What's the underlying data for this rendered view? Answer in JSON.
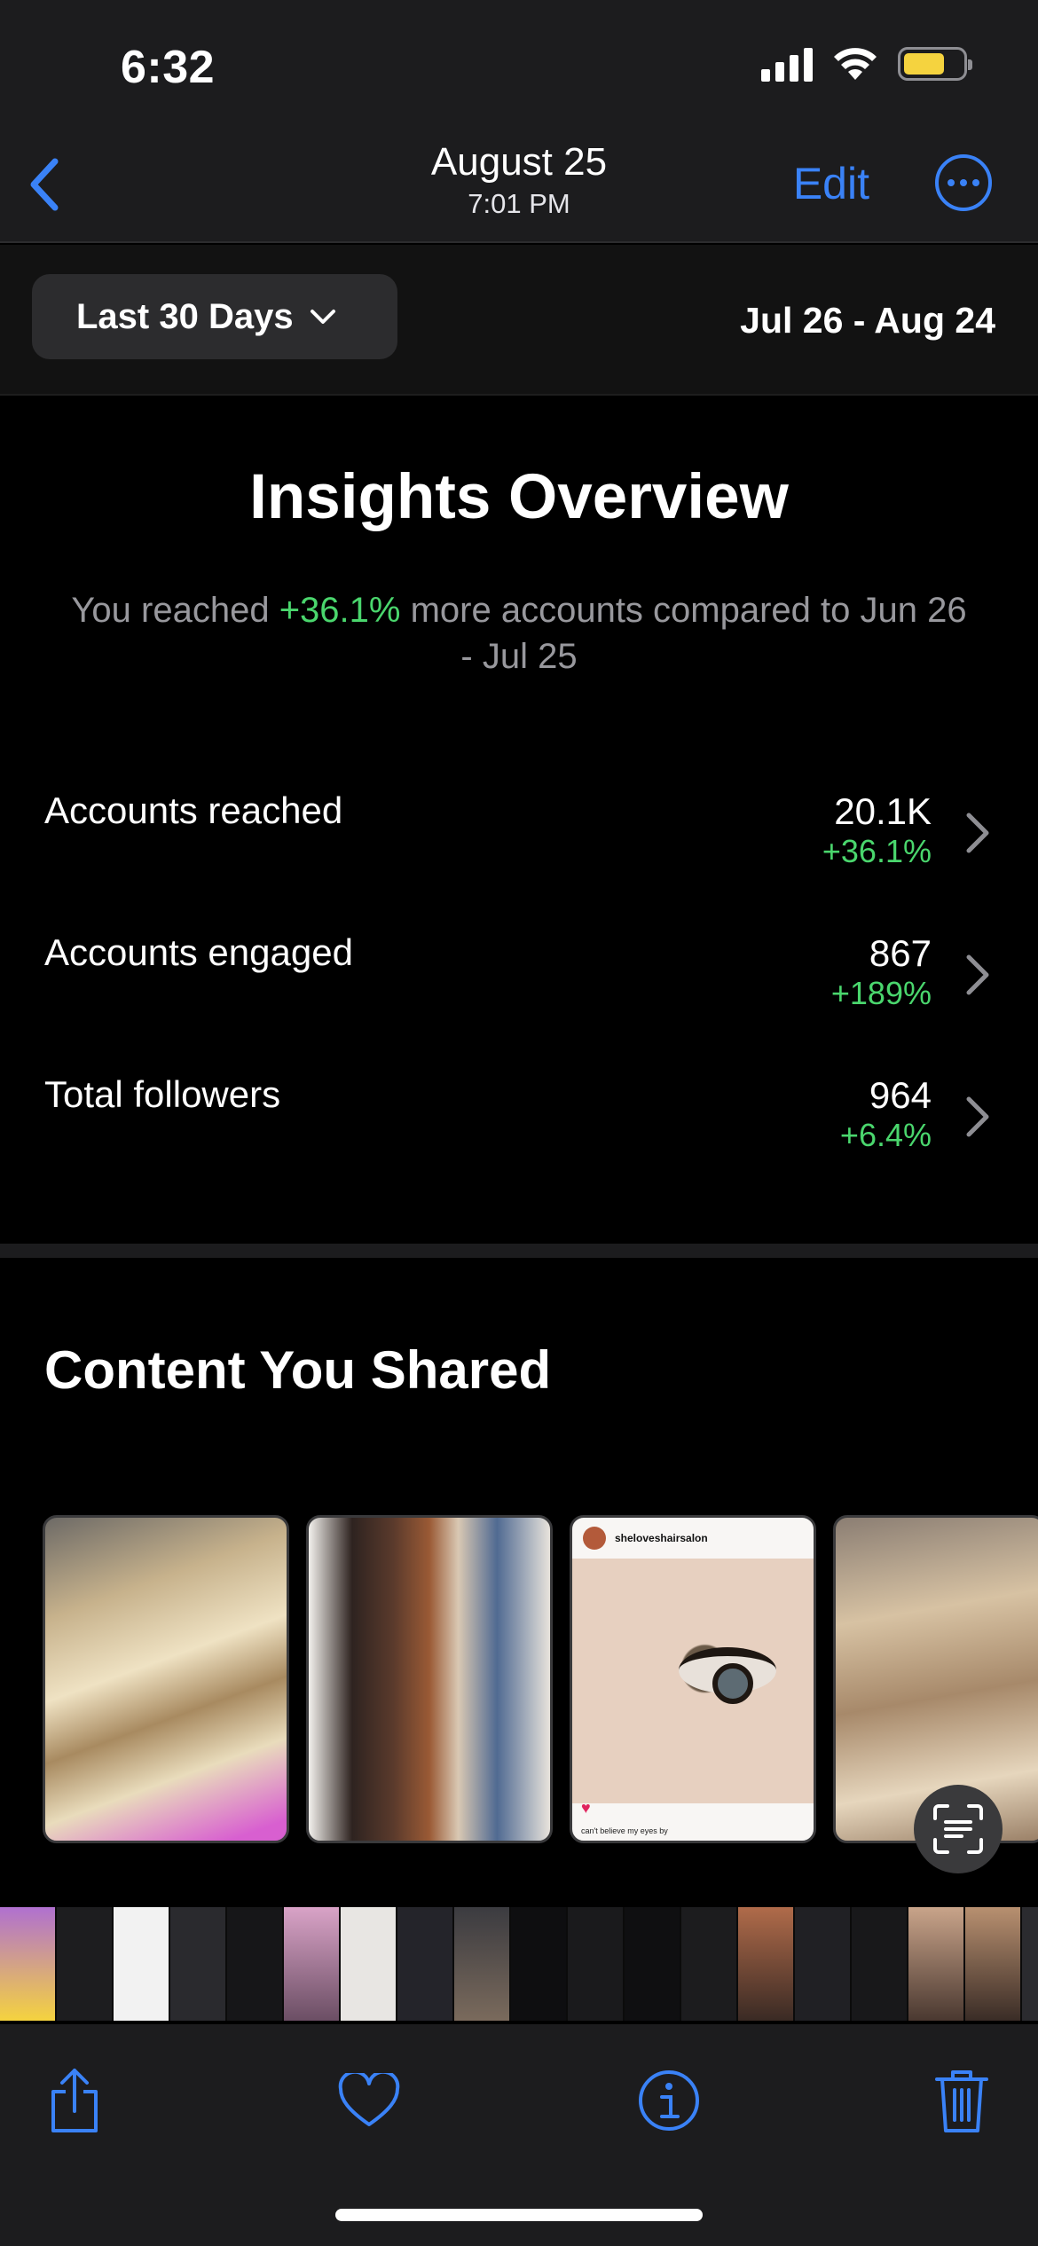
{
  "status_bar": {
    "time": "6:32",
    "battery_color": "#f5d33f"
  },
  "nav": {
    "date": "August 25",
    "time": "7:01 PM",
    "edit_label": "Edit",
    "accent_color": "#3a82f7"
  },
  "filter": {
    "range_label": "Last 30 Days",
    "date_range": "Jul 26 - Aug 24"
  },
  "overview": {
    "title": "Insights Overview",
    "subtitle_prefix": "You reached ",
    "subtitle_change": "+36.1%",
    "subtitle_suffix": " more accounts compared to Jun 26 - Jul 25",
    "metrics": [
      {
        "label": "Accounts reached",
        "value": "20.1K",
        "change": "+36.1%"
      },
      {
        "label": "Accounts engaged",
        "value": "867",
        "change": "+189%"
      },
      {
        "label": "Total followers",
        "value": "964",
        "change": "+6.4%"
      }
    ]
  },
  "content": {
    "title": "Content You Shared",
    "post_username": "sheloveshairsalon",
    "post_caption": "can't believe my eyes by"
  },
  "colors": {
    "positive": "#4ad66d",
    "background": "#000000",
    "panel": "#1c1c1e"
  },
  "toolbar": {
    "icons": [
      "share-icon",
      "heart-icon",
      "info-icon",
      "trash-icon"
    ]
  }
}
